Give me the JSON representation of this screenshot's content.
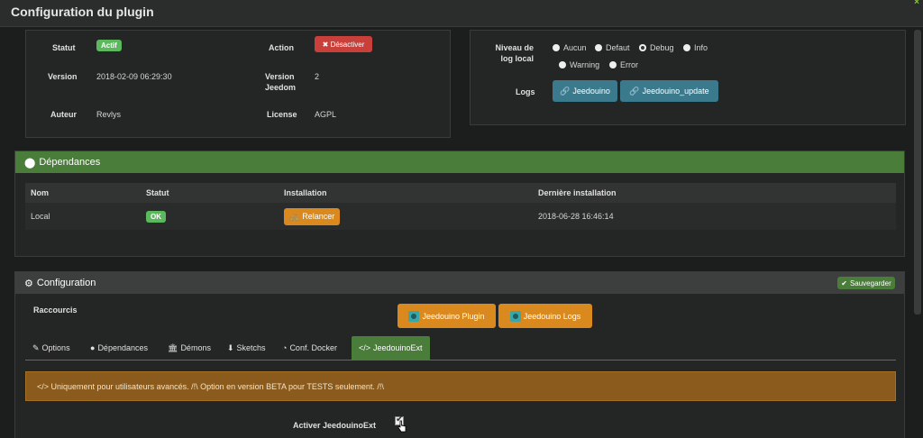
{
  "modal": {
    "title": "Configuration du plugin",
    "close": "×"
  },
  "info": {
    "statut_label": "Statut",
    "statut_value": "Actif",
    "action_label": "Action",
    "deactivate_label": "✖ Désactiver",
    "version_label": "Version",
    "version_value": "2018-02-09 06:29:30",
    "version_jeedom_label_1": "Version",
    "version_jeedom_label_2": "Jeedom",
    "version_jeedom_value": "2",
    "auteur_label": "Auteur",
    "auteur_value": "Revlys",
    "license_label": "License",
    "license_value": "AGPL"
  },
  "logs": {
    "niveau_label_1": "Niveau de",
    "niveau_label_2": "log local",
    "levels": [
      "Aucun",
      "Defaut",
      "Debug",
      "Info",
      "Warning",
      "Error"
    ],
    "selected": "Debug",
    "logs_label": "Logs",
    "buttons": [
      "Jeedouino",
      "Jeedouino_update"
    ]
  },
  "dependances": {
    "title": "Dépendances",
    "columns": [
      "Nom",
      "Statut",
      "Installation",
      "Dernière installation"
    ],
    "row": {
      "nom": "Local",
      "statut": "OK",
      "relancer": "Relancer",
      "derniere": "2018-06-28 16:46:14"
    }
  },
  "configuration": {
    "title": "Configuration",
    "save_label": "Sauvegarder",
    "raccourcis_label": "Raccourcis",
    "shortcuts": [
      "Jeedouino Plugin",
      "Jeedouino Logs"
    ],
    "tabs": [
      "Options",
      "Dépendances",
      "Démons",
      "Sketchs",
      "Conf. Docker",
      "JeedouinoExt"
    ],
    "warning": "</> Uniquement pour utilisateurs avancés. /!\\ Option en version BETA pour TESTS seulement. /!\\",
    "activer_label": "Activer JeedouinoExt"
  },
  "colors": {
    "green": "#4a7c3a",
    "orange": "#d9891e",
    "teal": "#3a7a8c",
    "red": "#c9403a"
  }
}
